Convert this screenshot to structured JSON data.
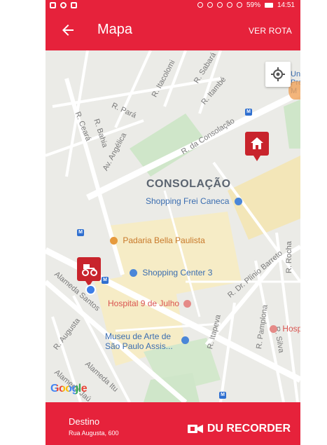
{
  "status_bar": {
    "battery": "59%",
    "time": "14:51"
  },
  "app_bar": {
    "back_icon": "arrow-left-icon",
    "title": "Mapa",
    "action": "VER ROTA"
  },
  "map": {
    "district": "CONSOLAÇÃO",
    "streets": [
      "R. Sabará",
      "R. Itacolomi",
      "R. Itambé",
      "R. Pará",
      "R. Bahia",
      "R. Ceará",
      "Av. Angélica",
      "R. da Consolação",
      "Alameda Santos",
      "R. Augusta",
      "Alameda Itu",
      "Alameda Jaú",
      "R. Dr. Plínio Barreto",
      "R. Rocha",
      "R. Silva",
      "R. Pamplona",
      "R. Itapeva"
    ],
    "pois": {
      "shopping_frei_caneca": "Shopping Frei Caneca",
      "padaria": "Padaria Bella Paulista",
      "shopping_center_3": "Shopping Center 3",
      "hospital": "Hospital 9 de Julho",
      "museum": "Museu de Arte de\nSão Paulo Assis...",
      "hospital_edge": "Hosp",
      "edge_label": "Un\nPre\nM"
    },
    "attribution": "Google",
    "markers": [
      "home-pin-icon",
      "delivery-pin-icon",
      "my-location-icon"
    ]
  },
  "bottom_bar": {
    "destination_label": "Destino",
    "destination_address": "Rua Augusta, 600",
    "brand": "DU RECORDER"
  },
  "colors": {
    "primary": "#e6223b",
    "pin": "#c8242c",
    "gps": "#3d7ee8"
  }
}
